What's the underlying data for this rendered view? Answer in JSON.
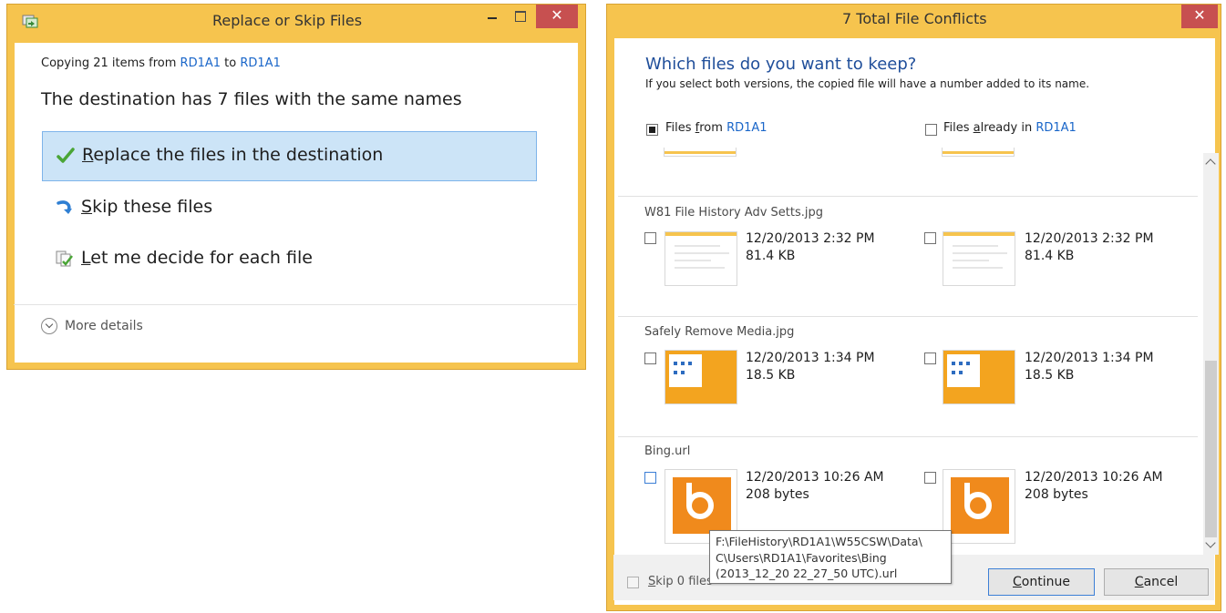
{
  "dialog1": {
    "title": "Replace or Skip Files",
    "copy_prefix": "Copying 21 items from ",
    "copy_source": "RD1A1",
    "copy_mid": " to ",
    "copy_dest": "RD1A1",
    "destination_message": "The destination has 7 files with the same names",
    "options": [
      {
        "label_first": "R",
        "label_rest": "eplace the files in the destination",
        "icon": "checkmark-icon",
        "selected": true
      },
      {
        "label_first": "S",
        "label_rest": "kip these files",
        "icon": "skip-arrow-icon",
        "selected": false
      },
      {
        "label_first": "L",
        "label_rest": "et me decide for each file",
        "icon": "decide-files-icon",
        "selected": false
      }
    ],
    "more_details": "More details",
    "close_glyph": "✕"
  },
  "dialog2": {
    "title": "7 Total File Conflicts",
    "question": "Which files do you want to keep?",
    "subtitle": "If you select both versions, the copied file will have a number added to its name.",
    "col_from_prefix": "Files ",
    "col_from_u": "f",
    "col_from_mid": "rom ",
    "col_from_loc": "RD1A1",
    "col_already_prefix": "Files ",
    "col_already_u": "a",
    "col_already_mid": "lready in ",
    "col_already_loc": "RD1A1",
    "files": [
      {
        "name": "W81 File History Adv Setts.jpg",
        "left_date": "12/20/2013 2:32 PM",
        "left_size": "81.4 KB",
        "right_date": "12/20/2013 2:32 PM",
        "right_size": "81.4 KB"
      },
      {
        "name": "Safely Remove Media.jpg",
        "left_date": "12/20/2013 1:34 PM",
        "left_size": "18.5 KB",
        "right_date": "12/20/2013 1:34 PM",
        "right_size": "18.5 KB"
      },
      {
        "name": "Bing.url",
        "left_date": "12/20/2013 10:26 AM",
        "left_size": "208 bytes",
        "right_date": "12/20/2013 10:26 AM",
        "right_size": "208 bytes"
      }
    ],
    "skip_label_u": "S",
    "skip_label_rest": "kip 0 files",
    "continue_label_u": "C",
    "continue_label_rest": "ontinue",
    "cancel_label_u": "C",
    "cancel_label_rest": "ancel",
    "close_glyph": "✕",
    "tooltip_lines": [
      "F:\\FileHistory\\RD1A1\\W55CSW\\Data\\",
      "C\\Users\\RD1A1\\Favorites\\Bing",
      "(2013_12_20 22_27_50 UTC).url"
    ]
  },
  "colors": {
    "window_frame": "#f6c44e",
    "close_button": "#c75050",
    "link_blue": "#1a66c9",
    "selection_fill": "#cce4f7",
    "selection_border": "#7eb4ea",
    "heading_blue": "#1f4e9a",
    "bing_orange": "#f08a1c"
  }
}
